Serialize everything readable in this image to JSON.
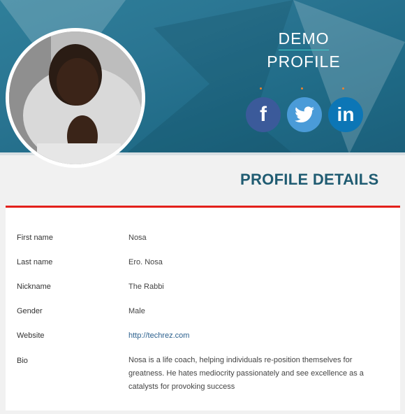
{
  "header": {
    "title_line1": "DEMO",
    "title_line2": "PROFILE"
  },
  "social": {
    "facebook": "f",
    "linkedin": "in",
    "icons": [
      "facebook-icon",
      "twitter-icon",
      "linkedin-icon"
    ]
  },
  "section_title": "PROFILE DETAILS",
  "colors": {
    "banner": "#2a7592",
    "accent_red": "#e3201b",
    "heading": "#205c72",
    "facebook": "#3b5a9a",
    "twitter": "#4a9bd8",
    "linkedin": "#0c76b6",
    "link": "#2a5f8d"
  },
  "details": [
    {
      "label": "First name",
      "value": "Nosa"
    },
    {
      "label": "Last name",
      "value": "Ero. Nosa"
    },
    {
      "label": "Nickname",
      "value": "The Rabbi"
    },
    {
      "label": "Gender",
      "value": "Male"
    },
    {
      "label": "Website",
      "value": "http://techrez.com"
    },
    {
      "label": "Bio",
      "value": "Nosa is a life coach, helping individuals re-position themselves for greatness. He hates mediocrity passionately and see excellence as a catalysts for provoking success"
    }
  ]
}
